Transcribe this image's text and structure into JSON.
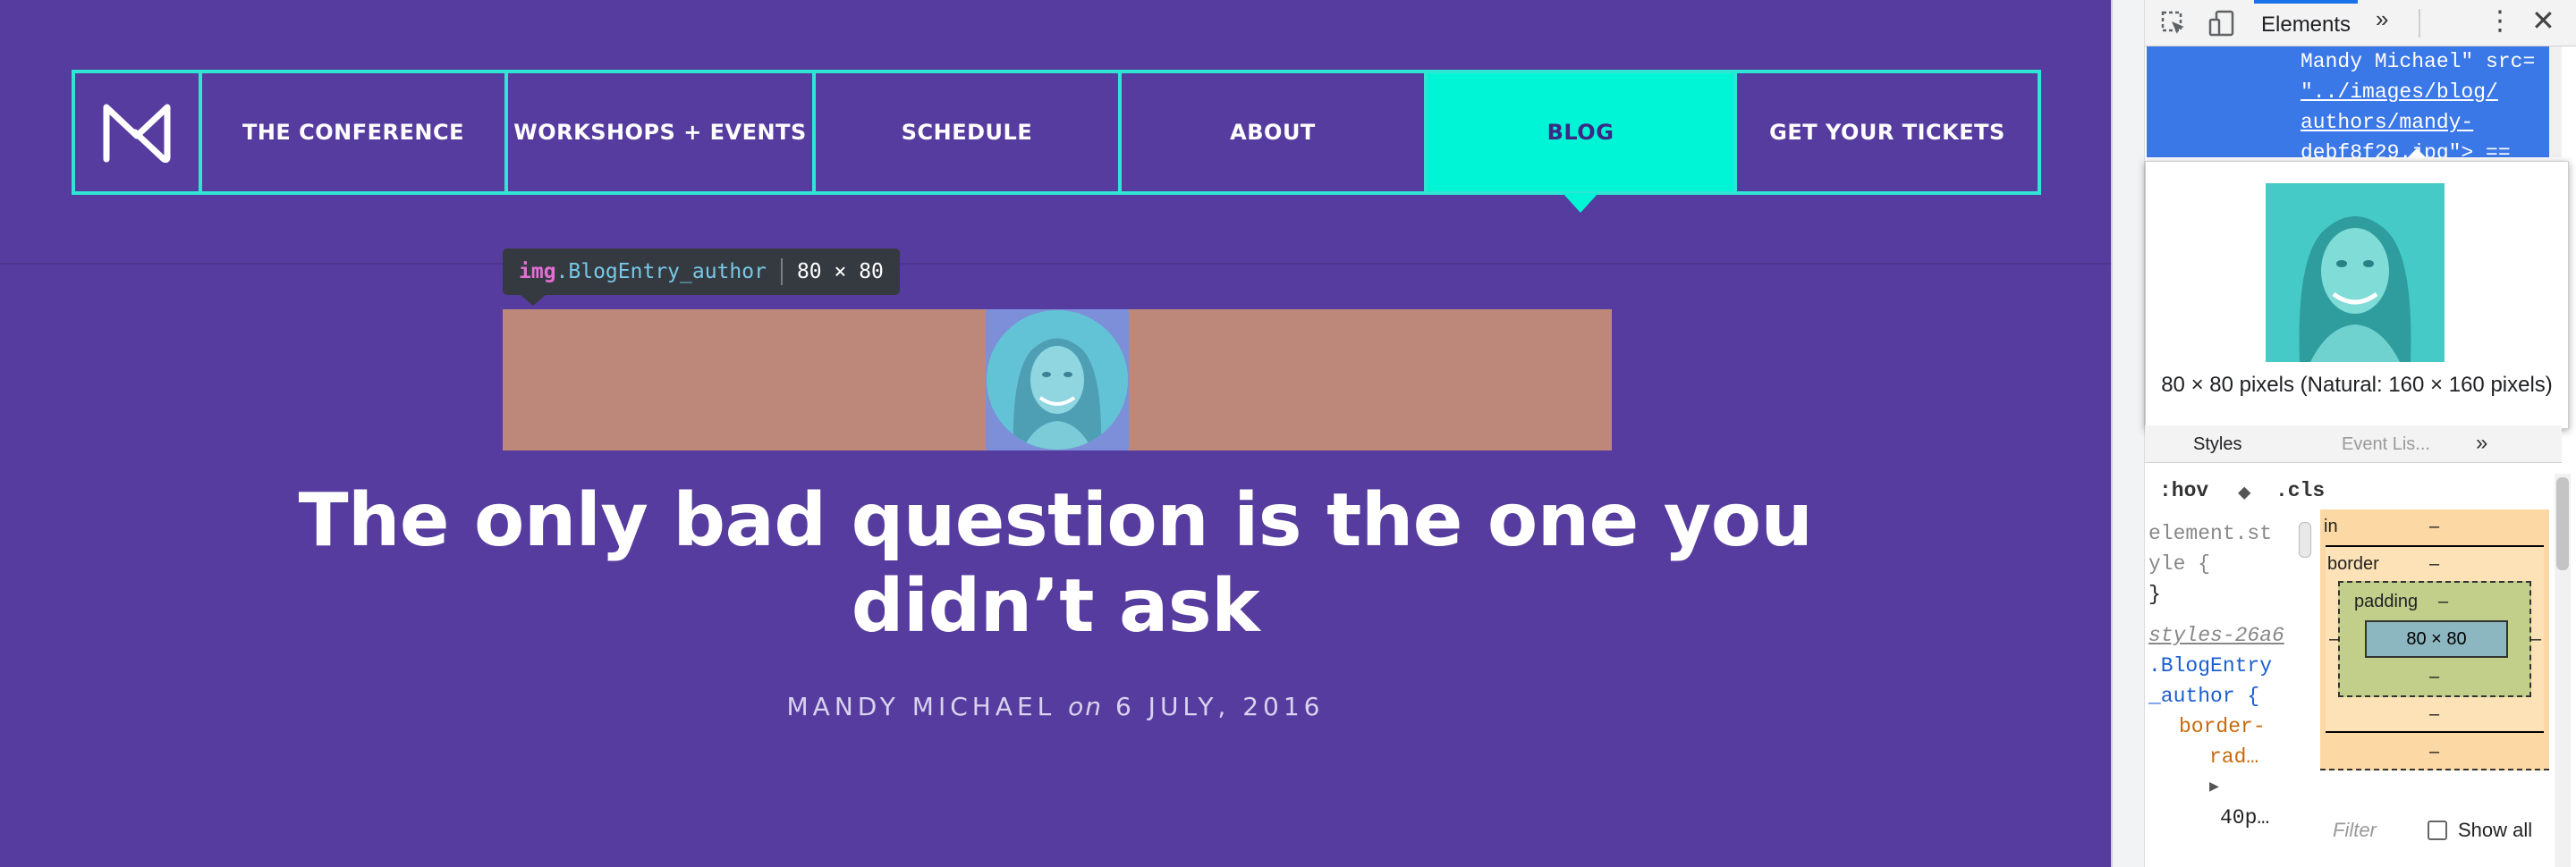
{
  "nav": {
    "logo_alt": "M",
    "items": [
      {
        "label": "THE CONFERENCE"
      },
      {
        "label": "WORKSHOPS + EVENTS"
      },
      {
        "label": "SCHEDULE"
      },
      {
        "label": "ABOUT"
      },
      {
        "label": "BLOG",
        "active": true
      },
      {
        "label": "GET YOUR TICKETS"
      }
    ]
  },
  "inspector_tooltip": {
    "tag": "img",
    "class": ".BlogEntry_author",
    "dimensions": "80 × 80"
  },
  "article": {
    "title_line1": "The only bad question is the one you",
    "title_line2": "didn’t ask",
    "author": "MANDY MICHAEL",
    "on": "on",
    "date": "6 JULY, 2016"
  },
  "devtools": {
    "active_tab": "Elements",
    "more_tabs": "»",
    "code_lines": [
      "Mandy Michael\" src=",
      "\"../images/blog/",
      "authors/mandy-",
      "debf8f29.jpg\"> =="
    ],
    "image_preview_caption": "80 × 80 pixels (Natural: 160 × 160 pixels)",
    "subtabs": {
      "styles": "Styles",
      "event_listeners": "Event Lis...",
      "more": "»"
    },
    "styles_bar": {
      "hov": ":hov",
      "cls": ".cls"
    },
    "rules": {
      "element_style_1": "element.st",
      "element_style_2": "yle {",
      "element_style_close": "}",
      "source_link": "styles-26a6",
      "selector_1": ".BlogEntry",
      "selector_2": "_author {",
      "prop_1": "border-",
      "prop_2": "rad…",
      "value": "40p…",
      "expand": "▶"
    },
    "box_model": {
      "margin_label": "in",
      "margin_value": "–",
      "border_label": "border",
      "border_value": "–",
      "padding_label": "padding",
      "padding_value": "–",
      "content": "80 × 80",
      "padding_bottom": "–",
      "border_bottom": "–",
      "margin_bottom": "–",
      "side_left": "–",
      "side_right": "–"
    },
    "filter": {
      "placeholder": "Filter",
      "show_all": "Show all"
    }
  },
  "colors": {
    "page_bg": "#563c9e",
    "nav_border": "#2fe5d4",
    "nav_active_bg": "#00f5d6",
    "author_strip": "#bd887a",
    "devtools_selection": "#3b78e7"
  }
}
